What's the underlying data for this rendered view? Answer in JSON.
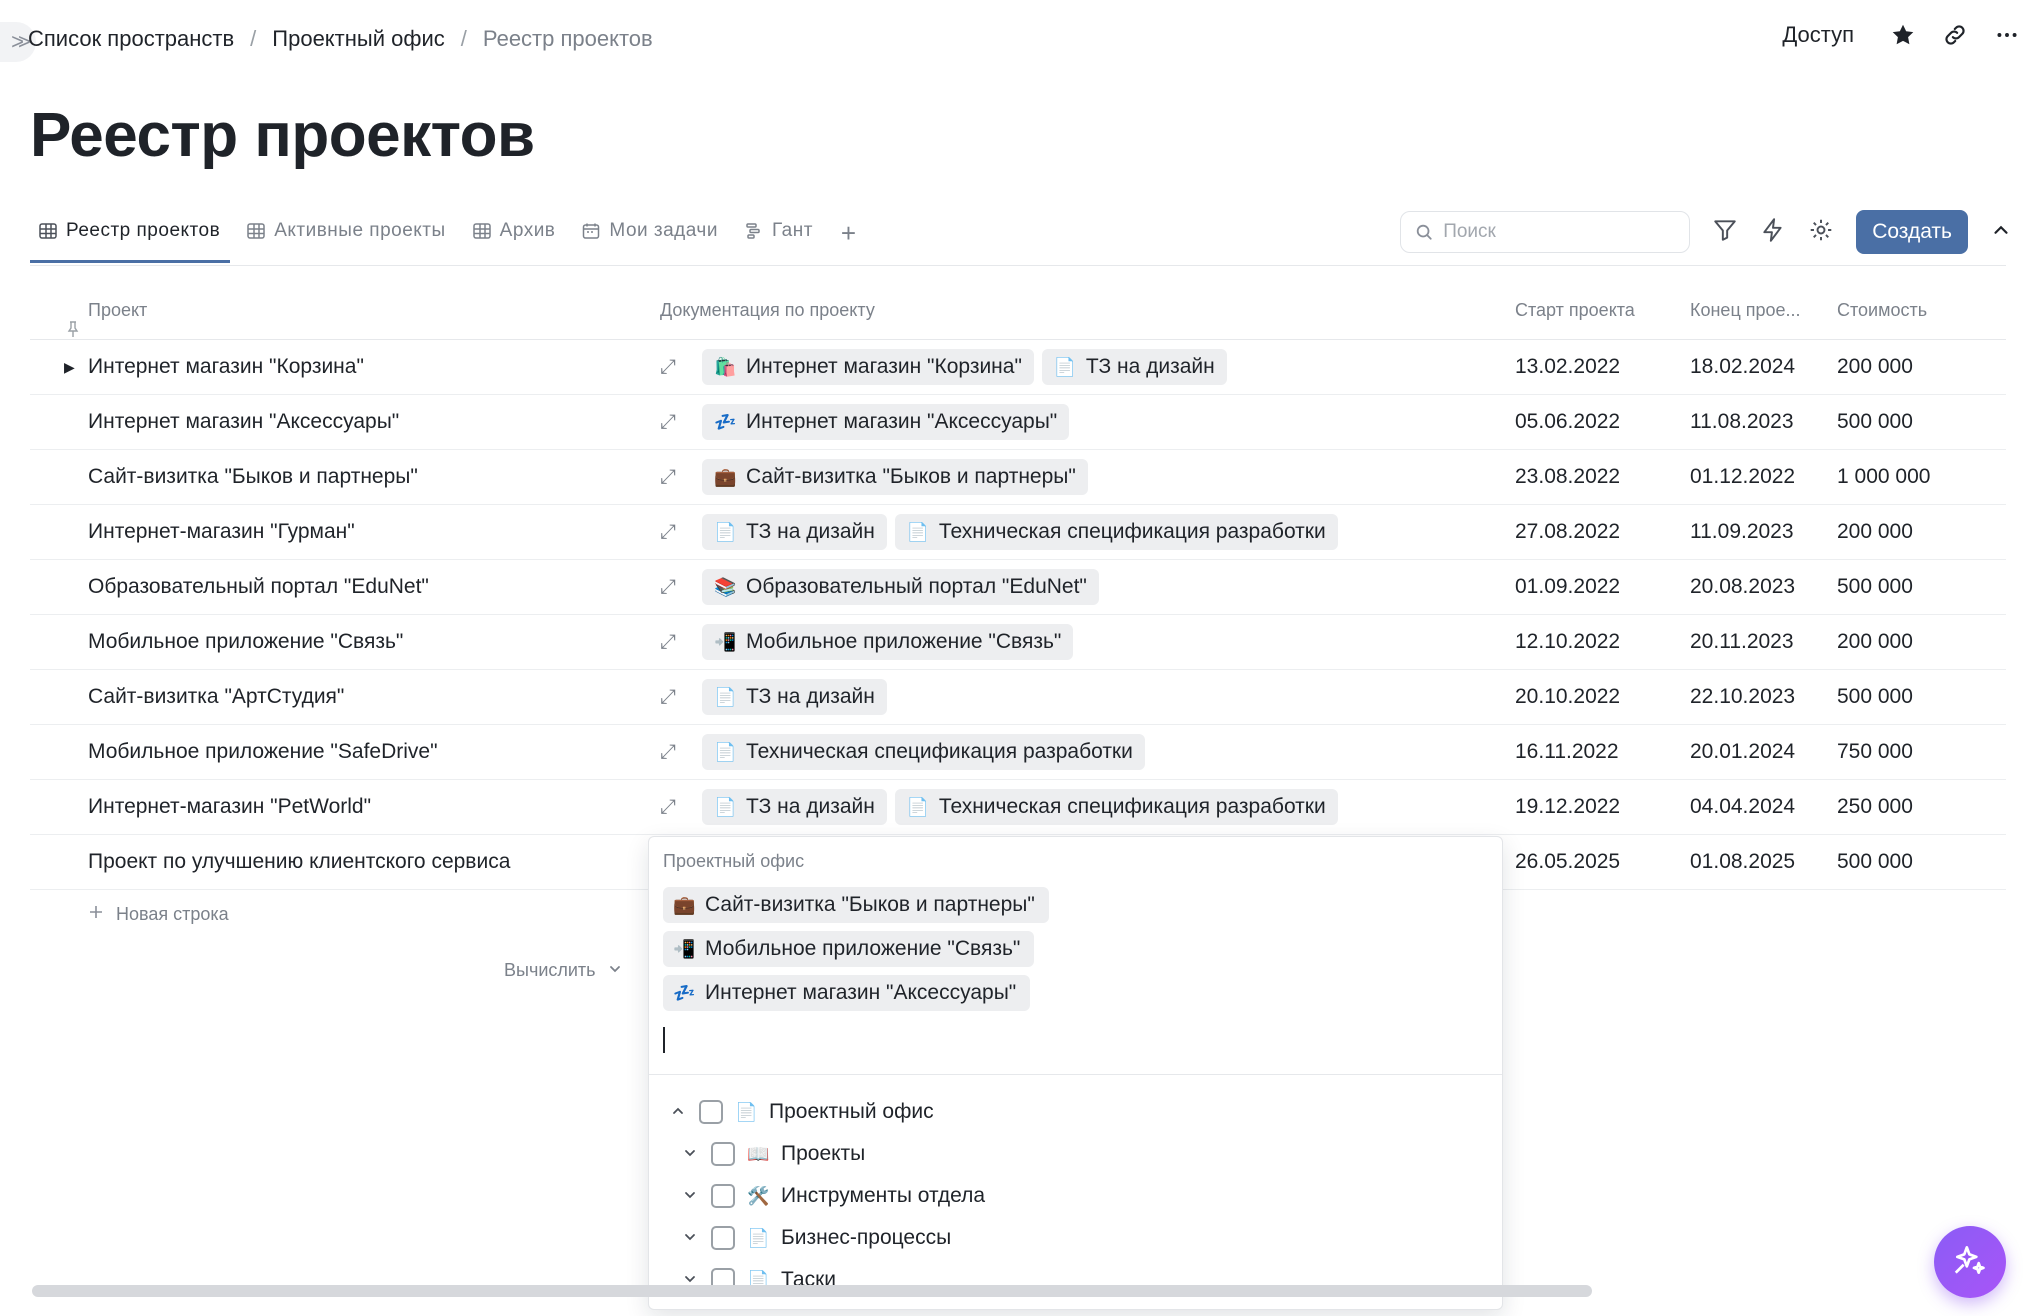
{
  "breadcrumb": {
    "items": [
      "Список пространств",
      "Проектный офис",
      "Реестр проектов"
    ],
    "separator": "/"
  },
  "header": {
    "access_label": "Доступ",
    "icons": [
      "star-icon",
      "link-icon",
      "more-icon"
    ]
  },
  "page": {
    "title": "Реестр проектов"
  },
  "tabs": [
    {
      "label": "Реестр проектов",
      "icon": "table-icon",
      "active": true
    },
    {
      "label": "Активные проекты",
      "icon": "table-icon",
      "active": false
    },
    {
      "label": "Архив",
      "icon": "table-icon",
      "active": false
    },
    {
      "label": "Мои задачи",
      "icon": "calendar-icon",
      "active": false
    },
    {
      "label": "Гант",
      "icon": "gantt-icon",
      "active": false
    }
  ],
  "toolbar": {
    "search_placeholder": "Поиск",
    "create_label": "Создать",
    "accent": "#4a6fa5"
  },
  "table": {
    "columns": [
      "Проект",
      "Документация по проекту",
      "Старт проекта",
      "Конец прое...",
      "Стоимость"
    ],
    "rows": [
      {
        "project": "Интернет магазин \"Корзина\"",
        "docs": [
          {
            "icon": "🛍️",
            "label": "Интернет магазин \"Корзина\""
          },
          {
            "icon": "📄",
            "label": "ТЗ на дизайн"
          }
        ],
        "start": "13.02.2022",
        "end": "18.02.2024",
        "cost": "200 000"
      },
      {
        "project": "Интернет магазин \"Аксессуары\"",
        "docs": [
          {
            "icon": "💤",
            "label": "Интернет магазин \"Аксессуары\""
          }
        ],
        "start": "05.06.2022",
        "end": "11.08.2023",
        "cost": "500 000"
      },
      {
        "project": "Сайт-визитка \"Быков и партнеры\"",
        "docs": [
          {
            "icon": "💼",
            "label": "Сайт-визитка \"Быков и партнеры\""
          }
        ],
        "start": "23.08.2022",
        "end": "01.12.2022",
        "cost": "1 000 000"
      },
      {
        "project": "Интернет-магазин \"Гурман\"",
        "docs": [
          {
            "icon": "📄",
            "label": "ТЗ на дизайн"
          },
          {
            "icon": "📄",
            "label": "Техническая спецификация разработки"
          }
        ],
        "start": "27.08.2022",
        "end": "11.09.2023",
        "cost": "200 000"
      },
      {
        "project": "Образовательный портал \"EduNet\"",
        "docs": [
          {
            "icon": "📚",
            "label": "Образовательный портал \"EduNet\""
          }
        ],
        "start": "01.09.2022",
        "end": "20.08.2023",
        "cost": "500 000"
      },
      {
        "project": "Мобильное приложение \"Связь\"",
        "docs": [
          {
            "icon": "📲",
            "label": "Мобильное приложение \"Связь\""
          }
        ],
        "start": "12.10.2022",
        "end": "20.11.2023",
        "cost": "200 000"
      },
      {
        "project": "Сайт-визитка \"АртСтудия\"",
        "docs": [
          {
            "icon": "📄",
            "label": "ТЗ на дизайн"
          }
        ],
        "start": "20.10.2022",
        "end": "22.10.2023",
        "cost": "500 000"
      },
      {
        "project": "Мобильное приложение \"SafeDrive\"",
        "docs": [
          {
            "icon": "📄",
            "label": "Техническая спецификация разработки"
          }
        ],
        "start": "16.11.2022",
        "end": "20.01.2024",
        "cost": "750 000"
      },
      {
        "project": "Интернет-магазин \"PetWorld\"",
        "docs": [
          {
            "icon": "📄",
            "label": "ТЗ на дизайн"
          },
          {
            "icon": "📄",
            "label": "Техническая спецификация разработки"
          }
        ],
        "start": "19.12.2022",
        "end": "04.04.2024",
        "cost": "250 000"
      },
      {
        "project": "Проект по улучшению клиентского сервиса",
        "docs": [],
        "start": "26.05.2025",
        "end": "01.08.2025",
        "cost": "500 000"
      }
    ],
    "new_row_label": "Новая строка",
    "calc_label": "Вычислить"
  },
  "popup": {
    "header": "Проектный офис",
    "selected": [
      {
        "icon": "💼",
        "label": "Сайт-визитка \"Быков и партнеры\""
      },
      {
        "icon": "📲",
        "label": "Мобильное приложение \"Связь\""
      },
      {
        "icon": "💤",
        "label": "Интернет магазин \"Аксессуары\""
      }
    ],
    "tree": [
      {
        "label": "Проектный офис",
        "icon": "📄",
        "expanded": true,
        "level": 0
      },
      {
        "label": "Проекты",
        "icon": "📖",
        "expanded": false,
        "level": 1
      },
      {
        "label": "Инструменты отдела",
        "icon": "🛠️",
        "expanded": false,
        "level": 1
      },
      {
        "label": "Бизнес-процессы",
        "icon": "📄",
        "expanded": false,
        "level": 1
      },
      {
        "label": "Таски",
        "icon": "📄",
        "expanded": false,
        "level": 1
      }
    ]
  },
  "fab": {
    "icon": "sparkle-icon",
    "color": "#8b5cf6"
  }
}
